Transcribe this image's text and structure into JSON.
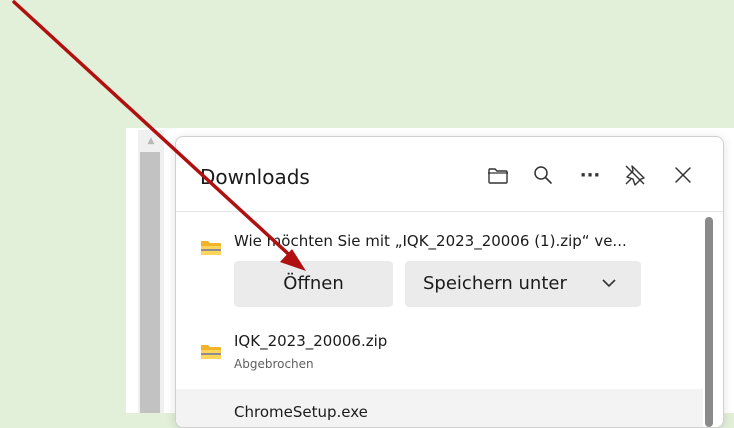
{
  "downloads": {
    "title": "Downloads",
    "header_icons": [
      "folder-icon",
      "search-icon",
      "more-icon",
      "unpin-icon",
      "close-icon"
    ],
    "more_label": "···",
    "items": [
      {
        "text": "Wie möchten Sie mit „IQK_2023_20006 (1).zip“ ve...",
        "icon": "zip-folder-icon",
        "open_label": "Öffnen",
        "save_as_label": "Speichern unter"
      },
      {
        "name": "IQK_2023_20006.zip",
        "status": "Abgebrochen",
        "icon": "zip-folder-icon"
      },
      {
        "name": "ChromeSetup.exe",
        "icon": "file-icon"
      }
    ]
  },
  "colors": {
    "page_background": "#e2efd9",
    "annotation_arrow": "#b01010"
  }
}
